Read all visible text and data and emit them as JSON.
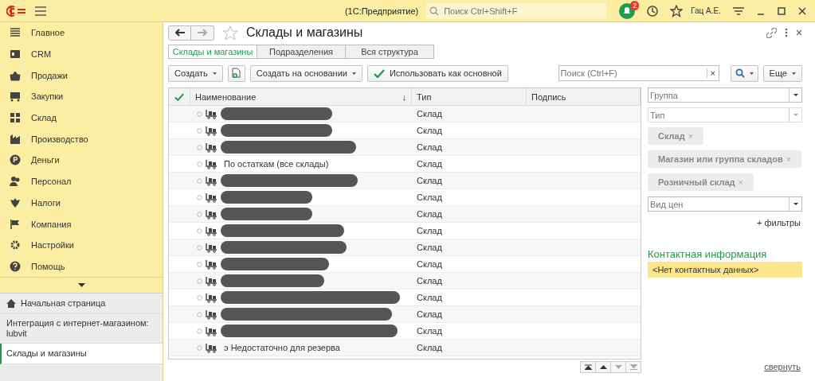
{
  "topbar": {
    "app_title": "(1С:Предприятие)",
    "search_placeholder": "Поиск Ctrl+Shift+F",
    "notifications_count": "2",
    "user": "Гац А.Е."
  },
  "sidebar": {
    "sections": [
      {
        "label": "Главное"
      },
      {
        "label": "CRM"
      },
      {
        "label": "Продажи"
      },
      {
        "label": "Закупки"
      },
      {
        "label": "Склад"
      },
      {
        "label": "Производство"
      },
      {
        "label": "Деньги"
      },
      {
        "label": "Персонал"
      },
      {
        "label": "Налоги"
      },
      {
        "label": "Компания"
      },
      {
        "label": "Настройки"
      },
      {
        "label": "Помощь"
      }
    ],
    "open_pages": [
      {
        "label": "Начальная страница",
        "kind": "home",
        "selected": false
      },
      {
        "label": "Интеграция с интернет-магазином: lubvit",
        "kind": "page",
        "selected": false
      },
      {
        "label": "Склады и магазины",
        "kind": "page",
        "selected": true
      }
    ]
  },
  "form": {
    "title": "Склады и магазины",
    "favorite": false,
    "tabs": [
      {
        "label": "Склады и магазины",
        "selected": true
      },
      {
        "label": "Подразделения",
        "selected": false
      },
      {
        "label": "Вся структура",
        "selected": false
      }
    ],
    "toolbar": {
      "create": "Создать",
      "create_based_on": "Создать на основании",
      "use_as_main": "Использовать как основной",
      "search_placeholder": "Поиск (Ctrl+F)",
      "clear": "×",
      "more": "Еще"
    },
    "table": {
      "columns": [
        "Наименование",
        "Тип",
        "Подпись"
      ],
      "sort_mark": "↓",
      "rows": [
        {
          "redacted": true,
          "type": "Склад"
        },
        {
          "redacted": true,
          "type": "Склад"
        },
        {
          "redacted": true,
          "type": "Склад"
        },
        {
          "redacted": false,
          "name": "По остаткам (все склады)",
          "type": "Склад"
        },
        {
          "redacted": true,
          "type": "Склад"
        },
        {
          "redacted": true,
          "type": "Склад"
        },
        {
          "redacted": true,
          "type": "Склад"
        },
        {
          "redacted": true,
          "type": "Склад"
        },
        {
          "redacted": true,
          "type": "Склад"
        },
        {
          "redacted": true,
          "type": "Склад"
        },
        {
          "redacted": true,
          "type": "Склад"
        },
        {
          "redacted": true,
          "type": "Склад"
        },
        {
          "redacted": true,
          "type": "Склад"
        },
        {
          "redacted": true,
          "type": "Склад"
        },
        {
          "redacted": false,
          "name": "э Недостаточно для резерва",
          "type": "Склад"
        }
      ]
    },
    "filters": {
      "group_placeholder": "Группа",
      "type_placeholder": "Тип",
      "tags": [
        "Склад",
        "Магазин или группа складов",
        "Розничный склад"
      ],
      "tag_remove": "×",
      "price_placeholder": "Вид цен",
      "add_filters": "+ фильтры"
    },
    "contacts": {
      "title": "Контактная информация",
      "value": "<Нет контактных данных>"
    },
    "collapse": "свернуть"
  }
}
